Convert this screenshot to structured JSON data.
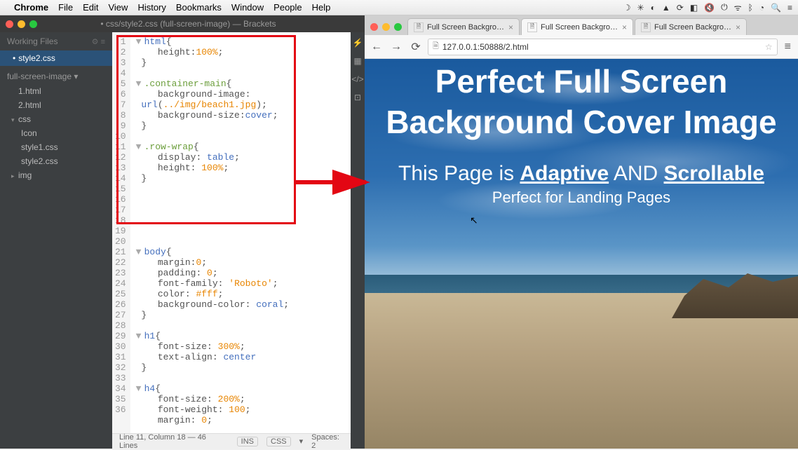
{
  "menubar": {
    "apple": "",
    "app": "Chrome",
    "items": [
      "File",
      "Edit",
      "View",
      "History",
      "Bookmarks",
      "Window",
      "People",
      "Help"
    ],
    "status": [
      "☽",
      "✳",
      "◐",
      "▲",
      "⟳",
      "◧",
      "🔇",
      "⏻",
      "ᯤ",
      "ᛒ",
      "◔",
      "🔍",
      "≡"
    ]
  },
  "brackets": {
    "title": "• css/style2.css (full-screen-image) — Brackets",
    "working_files_label": "Working Files",
    "files": [
      {
        "name": "style2.css",
        "active": true
      }
    ],
    "project": "full-screen-image ▾",
    "tree": [
      {
        "label": "1.html",
        "level": 1
      },
      {
        "label": "2.html",
        "level": 1
      },
      {
        "label": "css",
        "level": 1,
        "arrow": "▾"
      },
      {
        "label": "Icon",
        "level": 2
      },
      {
        "label": "style1.css",
        "level": 2
      },
      {
        "label": "style2.css",
        "level": 2
      },
      {
        "label": "img",
        "level": 1,
        "arrow": "▸"
      }
    ],
    "statusbar": {
      "pos": "Line 11, Column 18 — 46 Lines",
      "ins": "INS",
      "lang": "CSS",
      "err": "▾",
      "spaces": "Spaces: 2"
    },
    "code": {
      "lines": [
        "1",
        "2",
        "3",
        "4",
        "5",
        "6",
        "7",
        "8",
        "9",
        "10",
        "11",
        "12",
        "13",
        "14",
        "15",
        "16",
        "17",
        "18",
        "19",
        "20",
        "21",
        "22",
        "23",
        "24",
        "25",
        "26",
        "27",
        "28",
        "29",
        "30",
        "31",
        "32",
        "33",
        "34",
        "35",
        "36"
      ]
    }
  },
  "chrome": {
    "tabs": [
      {
        "title": "Full Screen Background",
        "active": false
      },
      {
        "title": "Full Screen Background",
        "active": true
      },
      {
        "title": "Full Screen Background",
        "active": false
      }
    ],
    "url": "127.0.0.1:50888/2.html",
    "page": {
      "h1a": "Perfect Full Screen",
      "h1b": "Background Cover Image",
      "h2_pre": "This Page is ",
      "h2_link1": "Adaptive",
      "h2_mid": " AND ",
      "h2_link2": "Scrollable",
      "h3": "Perfect for Landing Pages"
    }
  }
}
